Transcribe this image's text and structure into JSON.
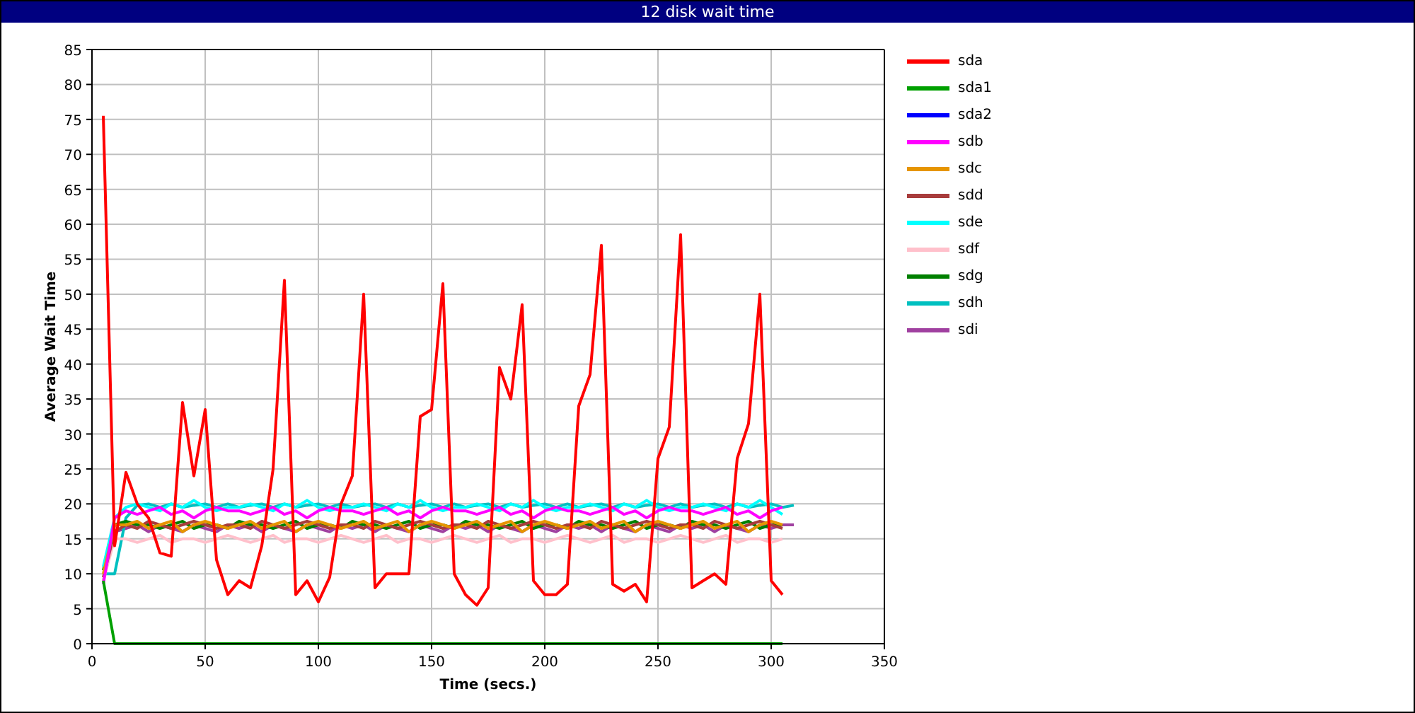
{
  "window": {
    "title": "12 disk wait time"
  },
  "chart": {
    "chart_data": {
      "type": "line",
      "xlabel": "Time (secs.)",
      "ylabel": "Average Wait Time",
      "grid": true,
      "xlim": [
        0,
        350
      ],
      "ylim": [
        0,
        85
      ],
      "xticks": [
        0,
        50,
        100,
        150,
        200,
        250,
        300,
        350
      ],
      "yticks": [
        0,
        5,
        10,
        15,
        20,
        25,
        30,
        35,
        40,
        45,
        50,
        55,
        60,
        65,
        70,
        75,
        80,
        85
      ],
      "x": [
        5,
        10,
        15,
        20,
        25,
        30,
        35,
        40,
        45,
        50,
        55,
        60,
        65,
        70,
        75,
        80,
        85,
        90,
        95,
        100,
        105,
        110,
        115,
        120,
        125,
        130,
        135,
        140,
        145,
        150,
        155,
        160,
        165,
        170,
        175,
        180,
        185,
        190,
        195,
        200,
        205,
        210,
        215,
        220,
        225,
        230,
        235,
        240,
        245,
        250,
        255,
        260,
        265,
        270,
        275,
        280,
        285,
        290,
        295,
        300,
        305,
        310
      ],
      "series": [
        {
          "name": "sda",
          "color": "#ff0000",
          "values": [
            75.5,
            14,
            24.5,
            20,
            18,
            13,
            12.5,
            34.5,
            24,
            33.5,
            12,
            7,
            9,
            8,
            14,
            25,
            52,
            7,
            9,
            6,
            9.5,
            20,
            24,
            50,
            8,
            10,
            10,
            10,
            32.5,
            33.5,
            51.5,
            10,
            7,
            5.5,
            8,
            39.5,
            35,
            48.5,
            9,
            7,
            7,
            8.5,
            34,
            38.5,
            57,
            8.5,
            7.5,
            8.5,
            6,
            26.5,
            31,
            58.5,
            8,
            9,
            10,
            8.5,
            26.5,
            31.5,
            50,
            9,
            7,
            null
          ]
        },
        {
          "name": "sda1",
          "color": "#00a000",
          "values": [
            9,
            0,
            0,
            0,
            0,
            0,
            0,
            0,
            0,
            0,
            0,
            0,
            0,
            0,
            0,
            0,
            0,
            0,
            0,
            0,
            0,
            0,
            0,
            0,
            0,
            0,
            0,
            0,
            0,
            0,
            0,
            0,
            0,
            0,
            0,
            0,
            0,
            0,
            0,
            0,
            0,
            0,
            0,
            0,
            0,
            0,
            0,
            0,
            0,
            0,
            0,
            0,
            0,
            0,
            0,
            0,
            0,
            0,
            0,
            0,
            0,
            null
          ]
        },
        {
          "name": "sda2",
          "color": "#0000ff",
          "values": [
            null,
            null,
            null,
            null,
            null,
            null,
            null,
            null,
            null,
            null,
            null,
            null,
            null,
            null,
            null,
            null,
            null,
            null,
            null,
            null,
            null,
            null,
            null,
            null,
            null,
            null,
            null,
            null,
            null,
            null,
            null,
            null,
            null,
            null,
            null,
            null,
            null,
            null,
            null,
            null,
            null,
            null,
            null,
            null,
            null,
            null,
            null,
            null,
            null,
            null,
            null,
            null,
            null,
            null,
            null,
            null,
            null,
            null,
            null,
            null,
            null,
            null
          ]
        },
        {
          "name": "sdb",
          "color": "#ff00ff",
          "values": [
            8.5,
            18,
            19,
            18.5,
            19,
            19.5,
            18.5,
            19,
            18,
            19,
            19.5,
            19,
            19,
            18.5,
            19,
            19.5,
            18.5,
            19,
            18,
            19,
            19.5,
            19,
            19,
            18.5,
            19,
            19.5,
            18.5,
            19,
            18,
            19,
            19.5,
            19,
            19,
            18.5,
            19,
            19.5,
            18.5,
            19,
            18,
            19,
            19.5,
            19,
            19,
            18.5,
            19,
            19.5,
            18.5,
            19,
            18,
            19,
            19.5,
            19,
            19,
            18.5,
            19,
            19.5,
            18.5,
            19,
            18,
            19,
            19.5,
            null
          ]
        },
        {
          "name": "sdc",
          "color": "#e69500",
          "values": [
            10,
            17,
            17,
            17.5,
            16.5,
            17,
            17.5,
            16,
            17,
            17.5,
            17,
            16.5,
            17,
            17.5,
            16.5,
            17,
            17.5,
            16,
            17,
            17.5,
            17,
            16.5,
            17,
            17.5,
            16.5,
            17,
            17.5,
            16,
            17,
            17.5,
            17,
            16.5,
            17,
            17.5,
            16.5,
            17,
            17.5,
            16,
            17,
            17.5,
            17,
            16.5,
            17,
            17.5,
            16.5,
            17,
            17.5,
            16,
            17,
            17.5,
            17,
            16.5,
            17,
            17.5,
            16.5,
            17,
            17.5,
            16,
            17,
            17.5,
            17,
            null
          ]
        },
        {
          "name": "sdd",
          "color": "#a83c3c",
          "values": [
            9.5,
            16,
            17,
            16.5,
            17.5,
            17,
            16.5,
            17,
            17.5,
            17,
            16.5,
            17,
            17,
            16.5,
            17.5,
            17,
            16.5,
            17,
            17.5,
            17,
            16.5,
            17,
            17,
            16.5,
            17.5,
            17,
            16.5,
            17,
            17.5,
            17,
            16.5,
            17,
            17,
            16.5,
            17.5,
            17,
            16.5,
            17,
            17.5,
            17,
            16.5,
            17,
            17,
            16.5,
            17.5,
            17,
            16.5,
            17,
            17.5,
            17,
            16.5,
            17,
            17,
            16.5,
            17.5,
            17,
            16.5,
            17,
            17.5,
            17,
            16.5,
            null
          ]
        },
        {
          "name": "sde",
          "color": "#00ffff",
          "values": [
            11,
            18,
            19.5,
            20,
            19.5,
            19,
            20,
            19.5,
            20.5,
            19.5,
            19,
            19.5,
            19.5,
            20,
            19.5,
            19,
            20,
            19.5,
            20.5,
            19.5,
            19,
            19.5,
            19.5,
            20,
            19.5,
            19,
            20,
            19.5,
            20.5,
            19.5,
            19,
            19.5,
            19.5,
            20,
            19.5,
            19,
            20,
            19.5,
            20.5,
            19.5,
            19,
            19.5,
            19.5,
            20,
            19.5,
            19,
            20,
            19.5,
            20.5,
            19.5,
            19,
            19.5,
            19.5,
            20,
            19.5,
            19,
            20,
            19.5,
            20.5,
            19.5,
            18.5,
            null
          ]
        },
        {
          "name": "sdf",
          "color": "#ffc0cb",
          "values": [
            9,
            15,
            15,
            14.5,
            15,
            15.5,
            14.5,
            15,
            15,
            14.5,
            15,
            15.5,
            15,
            14.5,
            15,
            15.5,
            14.5,
            15,
            15,
            14.5,
            15,
            15.5,
            15,
            14.5,
            15,
            15.5,
            14.5,
            15,
            15,
            14.5,
            15,
            15.5,
            15,
            14.5,
            15,
            15.5,
            14.5,
            15,
            15,
            14.5,
            15,
            15.5,
            15,
            14.5,
            15,
            15.5,
            14.5,
            15,
            15,
            14.5,
            15,
            15.5,
            15,
            14.5,
            15,
            15.5,
            14.5,
            15,
            15,
            14.5,
            15,
            null
          ]
        },
        {
          "name": "sdg",
          "color": "#007f00",
          "values": [
            10.5,
            17,
            17.5,
            17,
            17,
            16.5,
            17,
            17.5,
            16.5,
            17,
            17,
            16.5,
            17.5,
            17,
            17,
            16.5,
            17,
            17.5,
            16.5,
            17,
            17,
            16.5,
            17.5,
            17,
            17,
            16.5,
            17,
            17.5,
            16.5,
            17,
            17,
            16.5,
            17.5,
            17,
            17,
            16.5,
            17,
            17.5,
            16.5,
            17,
            17,
            16.5,
            17.5,
            17,
            17,
            16.5,
            17,
            17.5,
            16.5,
            17,
            17,
            16.5,
            17.5,
            17,
            17,
            16.5,
            17,
            17.5,
            16.5,
            17,
            17,
            null
          ]
        },
        {
          "name": "sdh",
          "color": "#00c0c0",
          "values": [
            10,
            10,
            18,
            19.8,
            20,
            19.5,
            20,
            19.5,
            19.8,
            20,
            19.5,
            20,
            19.5,
            19.8,
            20,
            19.5,
            20,
            19.5,
            19.8,
            20,
            19.5,
            20,
            19.5,
            19.8,
            20,
            19.5,
            20,
            19.5,
            19.8,
            20,
            19.5,
            20,
            19.5,
            19.8,
            20,
            19.5,
            20,
            19.5,
            19.8,
            20,
            19.5,
            20,
            19.5,
            19.8,
            20,
            19.5,
            20,
            19.5,
            19.8,
            20,
            19.5,
            20,
            19.5,
            19.8,
            20,
            19.5,
            20,
            19.5,
            19.8,
            20,
            19.5,
            19.8
          ]
        },
        {
          "name": "sdi",
          "color": "#a040a0",
          "values": [
            9,
            16,
            16.5,
            17,
            16,
            17,
            16.5,
            16,
            17,
            16.5,
            16,
            17,
            16.5,
            17,
            16,
            17,
            16.5,
            16,
            17,
            16.5,
            16,
            17,
            16.5,
            17,
            16,
            17,
            16.5,
            16,
            17,
            16.5,
            16,
            17,
            16.5,
            17,
            16,
            17,
            16.5,
            16,
            17,
            16.5,
            16,
            17,
            16.5,
            17,
            16,
            17,
            16.5,
            16,
            17,
            16.5,
            16,
            17,
            16.5,
            17,
            16,
            17,
            16.5,
            16,
            17,
            16.5,
            17,
            17
          ]
        }
      ]
    }
  }
}
